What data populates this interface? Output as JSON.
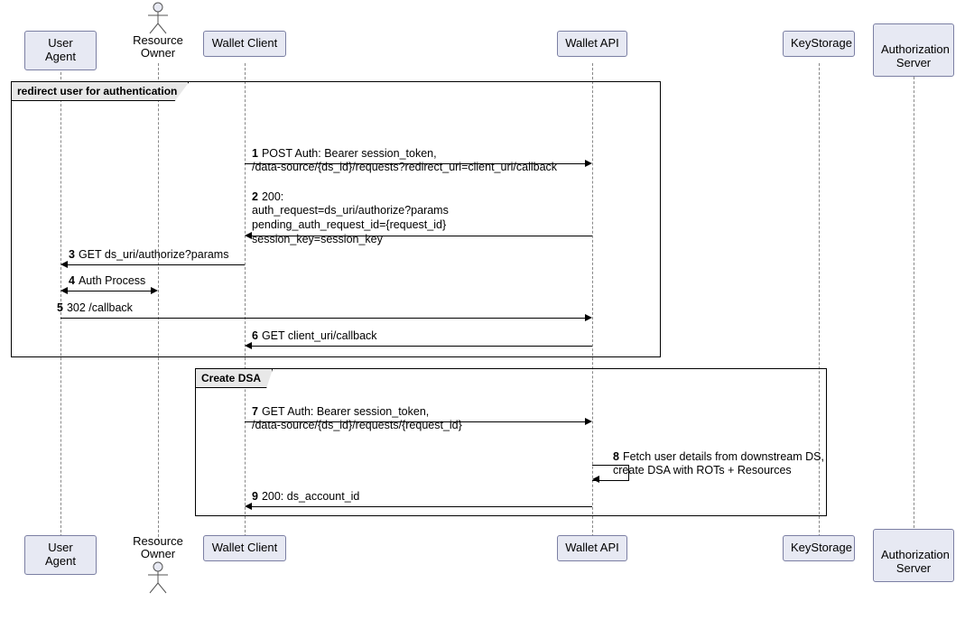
{
  "participants": {
    "user_agent": "User Agent",
    "resource_owner": "Resource\nOwner",
    "wallet_client": "Wallet Client",
    "wallet_api": "Wallet API",
    "key_storage": "KeyStorage",
    "auth_server": "Authorization\nServer"
  },
  "groups": {
    "g1": "redirect user for authentication",
    "g2": "Create DSA"
  },
  "messages": {
    "m1n": "1",
    "m1": "POST Auth: Bearer session_token,\n/data-source/{ds_id}/requests?redirect_uri=client_uri/callback",
    "m2n": "2",
    "m2": "200:\nauth_request=ds_uri/authorize?params\npending_auth_request_id={request_id}\nsession_key=session_key",
    "m3n": "3",
    "m3": "GET ds_uri/authorize?params",
    "m4n": "4",
    "m4": "Auth Process",
    "m5n": "5",
    "m5": "302 /callback",
    "m6n": "6",
    "m6": "GET client_uri/callback",
    "m7n": "7",
    "m7": "GET Auth: Bearer session_token,\n/data-source/{ds_id}/requests/{request_id}",
    "m8n": "8",
    "m8": "Fetch user details from downstream DS,\ncreate DSA with ROTs + Resources",
    "m9n": "9",
    "m9": "200: ds_account_id"
  }
}
